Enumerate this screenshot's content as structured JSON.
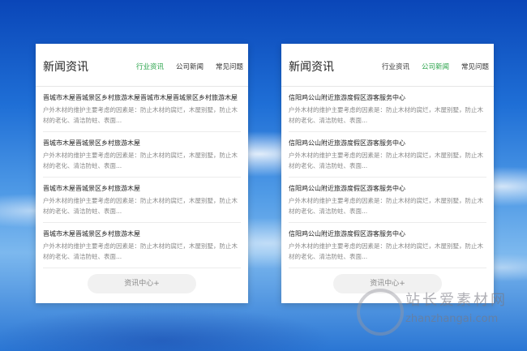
{
  "panels": [
    {
      "title": "新闻资讯",
      "tabs": [
        {
          "label": "行业资讯",
          "active": true
        },
        {
          "label": "公司新闻",
          "active": false
        },
        {
          "label": "常见问题",
          "active": false
        }
      ],
      "items": [
        {
          "title": "晋城市木屋晋城景区乡村旅游木屋晋城市木屋晋城景区乡村旅游木屋",
          "desc": "户外木材的维护主要考虑的因素是：防止木材的腐烂，木屋别墅，防止木材的老化、清洁防蛀、表面..."
        },
        {
          "title": "晋城市木屋晋城景区乡村旅游木屋",
          "desc": "户外木材的维护主要考虑的因素是：防止木材的腐烂，木屋别墅，防止木材的老化、清洁防蛀、表面..."
        },
        {
          "title": "晋城市木屋晋城景区乡村旅游木屋",
          "desc": "户外木材的维护主要考虑的因素是：防止木材的腐烂，木屋别墅，防止木材的老化、清洁防蛀、表面..."
        },
        {
          "title": "晋城市木屋晋城景区乡村旅游木屋",
          "desc": "户外木材的维护主要考虑的因素是：防止木材的腐烂，木屋别墅，防止木材的老化、清洁防蛀、表面..."
        }
      ],
      "more_label": "资讯中心+"
    },
    {
      "title": "新闻资讯",
      "tabs": [
        {
          "label": "行业资讯",
          "active": false
        },
        {
          "label": "公司新闻",
          "active": true
        },
        {
          "label": "常见问题",
          "active": false
        }
      ],
      "items": [
        {
          "title": "信阳鸡公山附近旅游度假区游客服务中心",
          "desc": "户外木材的维护主要考虑的因素是：防止木材的腐烂，木屋别墅，防止木材的老化、清洁防蛀、表面..."
        },
        {
          "title": "信阳鸡公山附近旅游度假区游客服务中心",
          "desc": "户外木材的维护主要考虑的因素是：防止木材的腐烂，木屋别墅，防止木材的老化、清洁防蛀、表面..."
        },
        {
          "title": "信阳鸡公山附近旅游度假区游客服务中心",
          "desc": "户外木材的维护主要考虑的因素是：防止木材的腐烂，木屋别墅，防止木材的老化、清洁防蛀、表面..."
        },
        {
          "title": "信阳鸡公山附近旅游度假区游客服务中心",
          "desc": "户外木材的维护主要考虑的因素是：防止木材的腐烂，木屋别墅，防止木材的老化、清洁防蛀、表面..."
        }
      ],
      "more_label": "资讯中心+"
    }
  ],
  "watermark": {
    "title": "站长爱素材网",
    "url": "zhanzhangai.com"
  },
  "colors": {
    "active_tab": "#29a34a",
    "background": "#1f6fd6"
  }
}
